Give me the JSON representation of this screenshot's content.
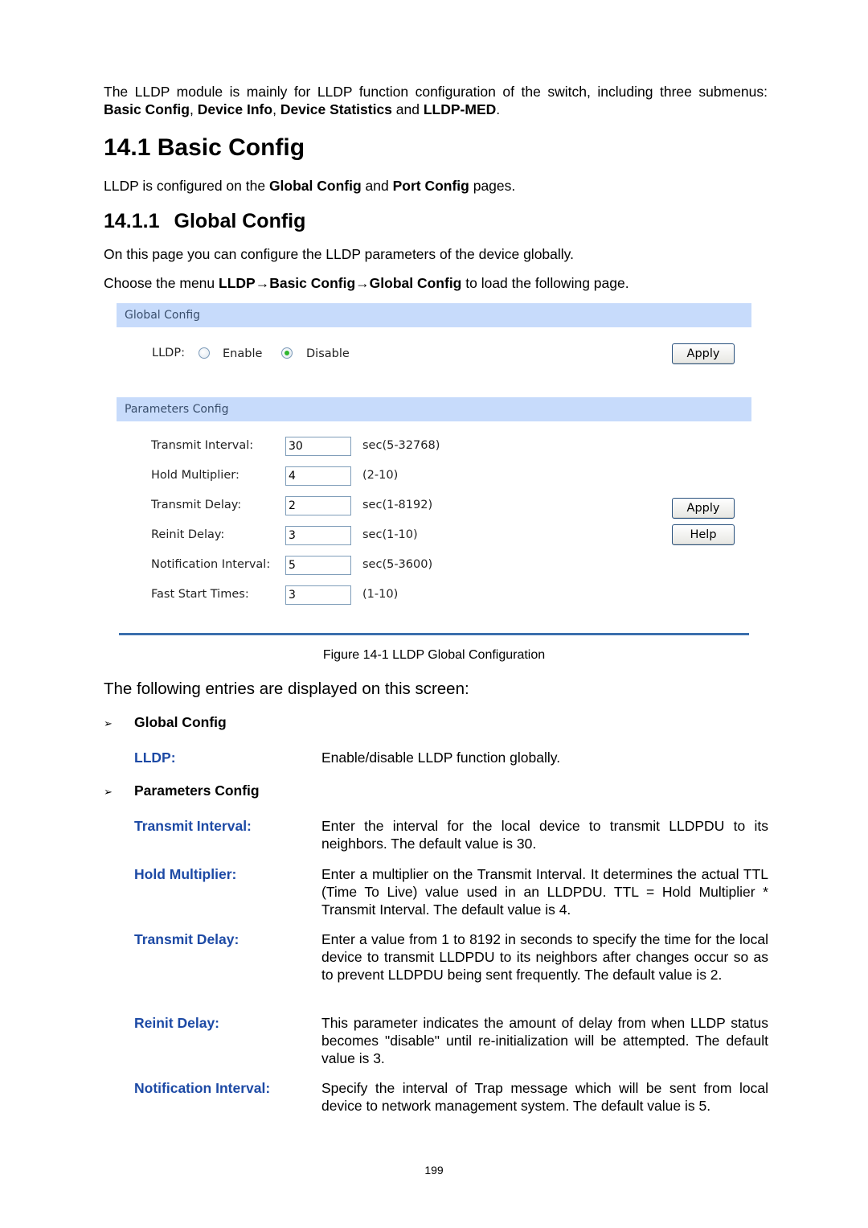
{
  "intro": {
    "text_parts": [
      {
        "t": "The LLDP module is mainly for LLDP function configuration of the switch, including three submenus: ",
        "b": false
      },
      {
        "t": "Basic Config",
        "b": true
      },
      {
        "t": ", ",
        "b": false
      },
      {
        "t": "Device Info",
        "b": true
      },
      {
        "t": ", ",
        "b": false
      },
      {
        "t": "Device Statistics",
        "b": true
      },
      {
        "t": " and ",
        "b": false
      },
      {
        "t": "LLDP-MED",
        "b": true
      },
      {
        "t": ".",
        "b": false
      }
    ]
  },
  "section": {
    "title": "14.1 Basic Config",
    "para_parts": [
      {
        "t": "LLDP is configured on the ",
        "b": false
      },
      {
        "t": "Global Config",
        "b": true
      },
      {
        "t": " and ",
        "b": false
      },
      {
        "t": "Port Config",
        "b": true
      },
      {
        "t": " pages.",
        "b": false
      }
    ]
  },
  "subsection": {
    "number": "14.1.1",
    "title": "Global Config",
    "para1": "On this page you can configure the LLDP parameters of the device globally.",
    "para2_parts": [
      {
        "t": "Choose the menu ",
        "b": false
      },
      {
        "t": "LLDP→Basic Config→Global Config",
        "b": true
      },
      {
        "t": " to load the following page.",
        "b": false
      }
    ]
  },
  "figure": {
    "global_bar": "Global Config",
    "lldp_label": "LLDP:",
    "radio_enable": "Enable",
    "radio_disable": "Disable",
    "lldp_selected": "Disable",
    "apply1": "Apply",
    "params_bar": "Parameters Config",
    "params": [
      {
        "label": "Transmit Interval:",
        "value": "30",
        "range": "sec(5-32768)"
      },
      {
        "label": "Hold Multiplier:",
        "value": "4",
        "range": "(2-10)"
      },
      {
        "label": "Transmit Delay:",
        "value": "2",
        "range": "sec(1-8192)"
      },
      {
        "label": "Reinit Delay:",
        "value": "3",
        "range": "sec(1-10)"
      },
      {
        "label": "Notification Interval:",
        "value": "5",
        "range": "sec(5-3600)"
      },
      {
        "label": "Fast Start Times:",
        "value": "3",
        "range": "(1-10)"
      }
    ],
    "apply2": "Apply",
    "help": "Help",
    "caption": "Figure 14-1 LLDP Global Configuration"
  },
  "entries_heading": "The following entries are displayed on this screen:",
  "groups": [
    {
      "title": "Global Config",
      "items": [
        {
          "term": "LLDP:",
          "desc": "Enable/disable LLDP function globally."
        }
      ]
    },
    {
      "title": "Parameters Config",
      "items": [
        {
          "term": "Transmit Interval:",
          "desc": "Enter the interval for the local device to transmit LLDPDU to its neighbors. The default value is 30."
        },
        {
          "term": "Hold Multiplier:",
          "desc": "Enter a multiplier on the Transmit Interval. It determines the actual TTL (Time To Live) value used in an LLDPDU. TTL = Hold Multiplier * Transmit Interval. The default value is 4."
        },
        {
          "term": "Transmit Delay:",
          "desc": "Enter a value from 1 to 8192 in seconds to specify the time for the local device to transmit LLDPDU to its neighbors after changes occur so as to prevent LLDPDU being sent frequently. The default value is 2."
        },
        {
          "term": "Reinit Delay:",
          "desc": "This parameter indicates the amount of delay from when LLDP status becomes \"disable\" until re-initialization will be attempted. The default value is 3."
        },
        {
          "term": "Notification Interval:",
          "desc": "Specify the interval of Trap message which will be sent from local device to network management system. The default value is 5."
        }
      ]
    }
  ],
  "page_number": "199",
  "colors": {
    "term_blue": "#1d4aa5",
    "bar_blue": "#c7dbfb",
    "rule_blue": "#3b6fad"
  }
}
